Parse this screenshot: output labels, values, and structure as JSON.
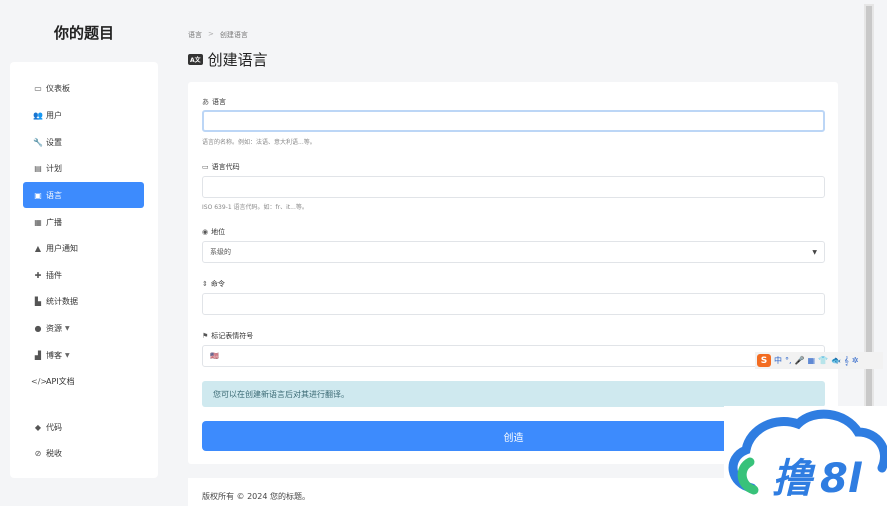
{
  "brand": {
    "title": "你的题目"
  },
  "sidebar": {
    "items": [
      {
        "icon": "monitor-icon",
        "glyph": "▭",
        "label": "仪表板"
      },
      {
        "icon": "users-icon",
        "glyph": "👥",
        "label": "用户"
      },
      {
        "icon": "wrench-icon",
        "glyph": "🔧",
        "label": "设置"
      },
      {
        "icon": "clipboard-icon",
        "glyph": "▤",
        "label": "计划"
      },
      {
        "icon": "language-icon",
        "glyph": "▣",
        "label": "语言"
      },
      {
        "icon": "broadcast-icon",
        "glyph": "▦",
        "label": "广播"
      },
      {
        "icon": "bell-icon",
        "glyph": "▲",
        "label": "用户通知"
      },
      {
        "icon": "puzzle-icon",
        "glyph": "✚",
        "label": "插件"
      },
      {
        "icon": "chart-icon",
        "glyph": "▙",
        "label": "统计数据"
      },
      {
        "icon": "info-icon",
        "glyph": "●",
        "label": "资源"
      },
      {
        "icon": "blog-icon",
        "glyph": "▟",
        "label": "博客"
      },
      {
        "icon": "code-icon",
        "glyph": "</>",
        "label": "API文档"
      },
      {
        "icon": "tag-icon",
        "glyph": "◆",
        "label": "代码"
      },
      {
        "icon": "paperclip-icon",
        "glyph": "⊘",
        "label": "税收"
      },
      {
        "icon": "partial-icon",
        "glyph": "",
        "label": ""
      }
    ]
  },
  "breadcrumb": {
    "parent": "语言",
    "separator": ">",
    "current": "创建语言"
  },
  "page": {
    "badge": "A文",
    "title": "创建语言"
  },
  "form": {
    "name": {
      "label": "语言",
      "value": "",
      "hint": "语言的名称。例如：法语、意大利语...等。"
    },
    "code": {
      "label": "语言代码",
      "value": "",
      "hint": "ISO 639-1 语言代码。如：fr、it...等。"
    },
    "status": {
      "label": "地位",
      "value": "系级的",
      "arrow": "▼"
    },
    "order": {
      "label": "命令",
      "value": ""
    },
    "flag": {
      "label": "标记表情符号",
      "placeholder": "🇺🇸"
    },
    "notice": "您可以在创建新语言后对其进行翻译。",
    "submit_label": "创造"
  },
  "footer": {
    "text": "版权所有 © 2024 您的标题。"
  },
  "ime": {
    "logo": "S",
    "items": [
      "中",
      "°,",
      "🎤",
      "▦",
      "👕",
      "🐟",
      "𝄞",
      "✲"
    ]
  },
  "colors": {
    "accent": "#3d8bfd",
    "notice_bg": "#cfe9ef",
    "notice_text": "#3b6a74"
  }
}
